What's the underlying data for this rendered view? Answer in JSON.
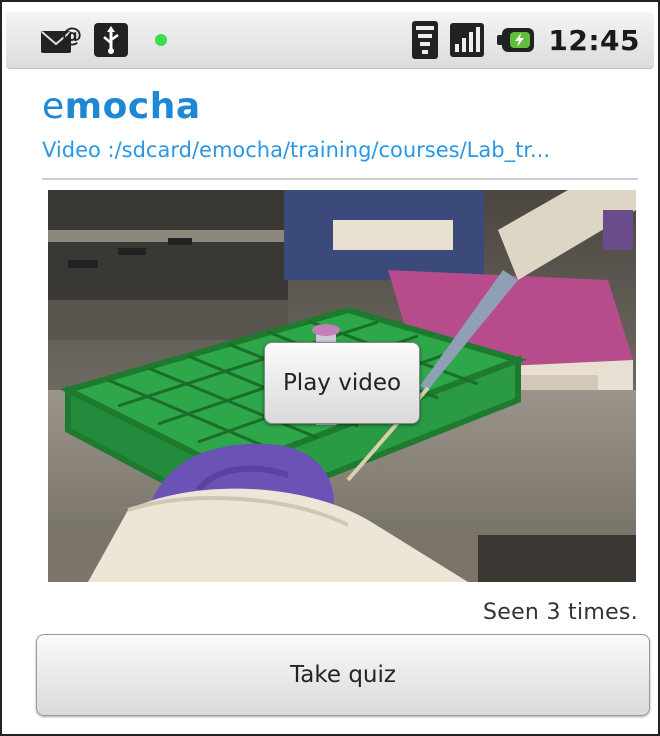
{
  "status_bar": {
    "time": "12:45",
    "icons": [
      "email-notification-icon",
      "usb-icon",
      "led-dot-icon",
      "wifi-icon",
      "signal-icon",
      "battery-charging-icon"
    ],
    "led_color": "#3ddc4a"
  },
  "header": {
    "app_name_prefix": "e",
    "app_name_rest": "mocha",
    "video_path": "Video :/sdcard/emocha/training/courses/Lab_tr..."
  },
  "video": {
    "play_label": "Play video"
  },
  "seen_text": "Seen 3 times.",
  "quiz_label": "Take quiz",
  "colors": {
    "brand": "#1e88d6",
    "link": "#2a97e6"
  }
}
